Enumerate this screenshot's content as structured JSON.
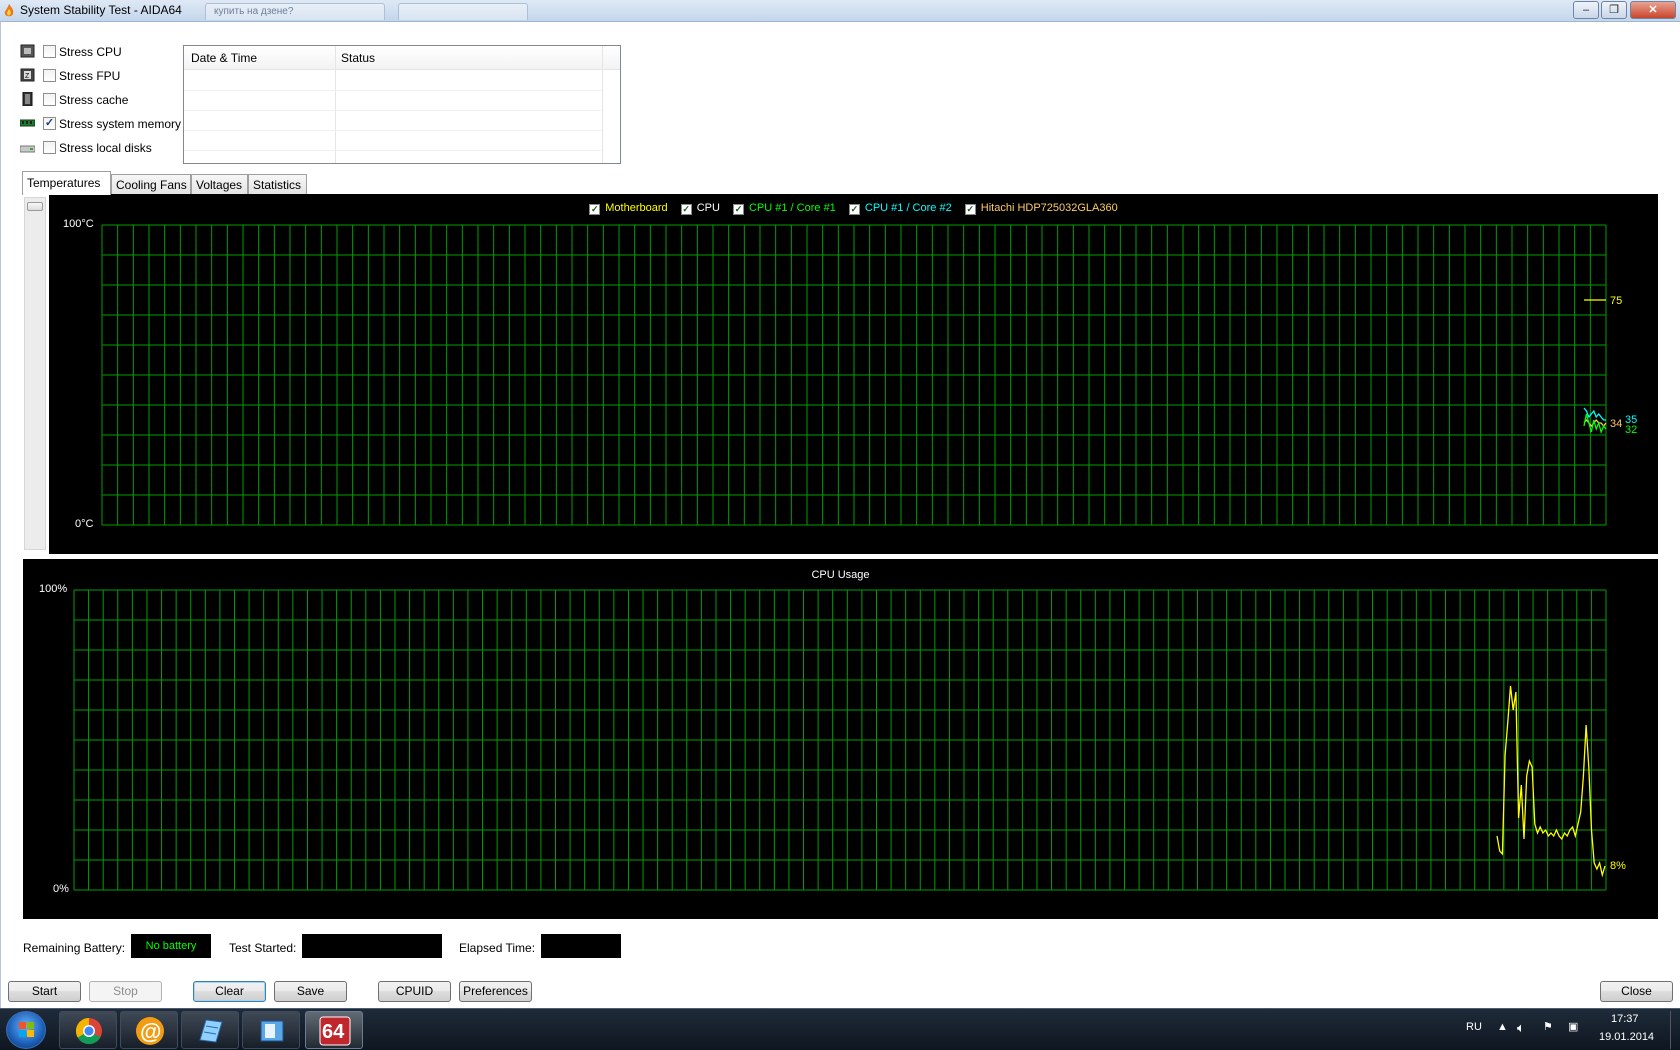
{
  "window": {
    "title": "System Stability Test - AIDA64",
    "ghost_tabs": [
      "купить на дзене?",
      ""
    ]
  },
  "stress_options": [
    {
      "label": "Stress CPU",
      "checked": false,
      "icon": "cpu-chip-icon"
    },
    {
      "label": "Stress FPU",
      "checked": false,
      "icon": "fpu-chip-icon"
    },
    {
      "label": "Stress cache",
      "checked": false,
      "icon": "cache-chip-icon"
    },
    {
      "label": "Stress system memory",
      "checked": true,
      "icon": "memory-module-icon"
    },
    {
      "label": "Stress local disks",
      "checked": false,
      "icon": "hard-disk-icon"
    }
  ],
  "log": {
    "columns": [
      "Date & Time",
      "Status"
    ]
  },
  "tabs": [
    "Temperatures",
    "Cooling Fans",
    "Voltages",
    "Statistics"
  ],
  "temperature_graph": {
    "legend": [
      {
        "label": "Motherboard",
        "color": "#ffff00"
      },
      {
        "label": "CPU",
        "color": "#ffffff"
      },
      {
        "label": "CPU #1 / Core #1",
        "color": "#00ff00"
      },
      {
        "label": "CPU #1 / Core #2",
        "color": "#00ffff"
      },
      {
        "label": "Hitachi HDP725032GLA360",
        "color": "#ffcc66"
      }
    ],
    "y_max_label": "100°C",
    "y_min_label": "0°C",
    "current_values": {
      "hdd": "75",
      "motherboard": "34",
      "core2": "35",
      "core1": "32"
    }
  },
  "cpu_usage_graph": {
    "title": "CPU Usage",
    "y_max_label": "100%",
    "y_min_label": "0%",
    "current_value": "8%"
  },
  "chart_data": [
    {
      "type": "line",
      "title": "",
      "ylabel": "",
      "ylim": [
        0,
        100
      ],
      "grid": true,
      "series": [
        {
          "name": "Hitachi HDP725032GLA360",
          "values": [
            75,
            75,
            75,
            75,
            75,
            75,
            75,
            75,
            75,
            75
          ]
        },
        {
          "name": "Motherboard",
          "values": [
            34,
            35,
            34,
            33,
            34,
            35,
            34,
            34,
            33,
            34
          ]
        },
        {
          "name": "CPU #1 / Core #2",
          "values": [
            39,
            38,
            36,
            37,
            38,
            36,
            37,
            36,
            35,
            35
          ]
        },
        {
          "name": "CPU #1 / Core #1",
          "values": [
            33,
            37,
            34,
            31,
            35,
            32,
            34,
            31,
            33,
            32
          ]
        }
      ]
    },
    {
      "type": "line",
      "title": "CPU Usage",
      "ylabel": "",
      "ylim": [
        0,
        100
      ],
      "grid": true,
      "series": [
        {
          "name": "",
          "values": [
            18,
            13,
            12,
            45,
            56,
            68,
            60,
            66,
            24,
            35,
            17,
            38,
            43,
            41,
            22,
            19,
            21,
            19,
            20,
            18,
            19,
            18,
            20,
            18,
            17,
            19,
            18,
            20,
            21,
            18,
            22,
            26,
            38,
            55,
            41,
            20,
            9,
            7,
            9,
            5,
            8
          ]
        }
      ]
    }
  ],
  "status_bar": {
    "battery_label": "Remaining Battery:",
    "battery_value": "No battery",
    "test_started_label": "Test Started:",
    "test_started_value": "",
    "elapsed_label": "Elapsed Time:",
    "elapsed_value": ""
  },
  "buttons": {
    "start": "Start",
    "stop": "Stop",
    "clear": "Clear",
    "save": "Save",
    "cpuid": "CPUID",
    "preferences": "Preferences",
    "close": "Close"
  },
  "taskbar": {
    "language": "RU",
    "time": "17:37",
    "date": "19.01.2014",
    "apps": [
      "chrome-icon",
      "mail-agent-icon",
      "notepad-icon",
      "explorer-icon",
      "aida64-icon"
    ],
    "aida_label": "64"
  }
}
